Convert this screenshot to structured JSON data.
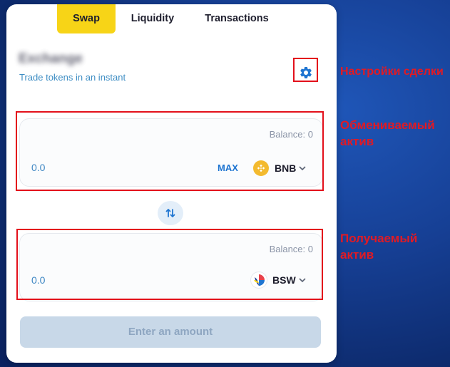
{
  "tabs": [
    {
      "label": "Swap",
      "active": true
    },
    {
      "label": "Liquidity",
      "active": false
    },
    {
      "label": "Transactions",
      "active": false
    }
  ],
  "header": {
    "title": "Exchange",
    "subtitle": "Trade tokens in an instant",
    "settings_icon": "gear-icon"
  },
  "from": {
    "balance": "Balance: 0",
    "amount": "0.0",
    "max_label": "MAX",
    "token": "BNB",
    "token_icon": "bnb-icon",
    "token_color": "#f3ba2f"
  },
  "switch_icon": "swap-arrows-icon",
  "to": {
    "balance": "Balance: 0",
    "amount": "0.0",
    "token": "BSW",
    "token_icon": "bsw-icon"
  },
  "cta_label": "Enter an amount",
  "annotations": {
    "settings": "Настройки сделки",
    "from_line1": "Обмениваемый",
    "from_line2": "актив",
    "to_line1": "Получаемый",
    "to_line2": "актив"
  },
  "colors": {
    "accent_yellow": "#f7d417",
    "link_blue": "#1f75d1",
    "annotation_red": "#e3101b",
    "background_blue": "#163f94"
  }
}
